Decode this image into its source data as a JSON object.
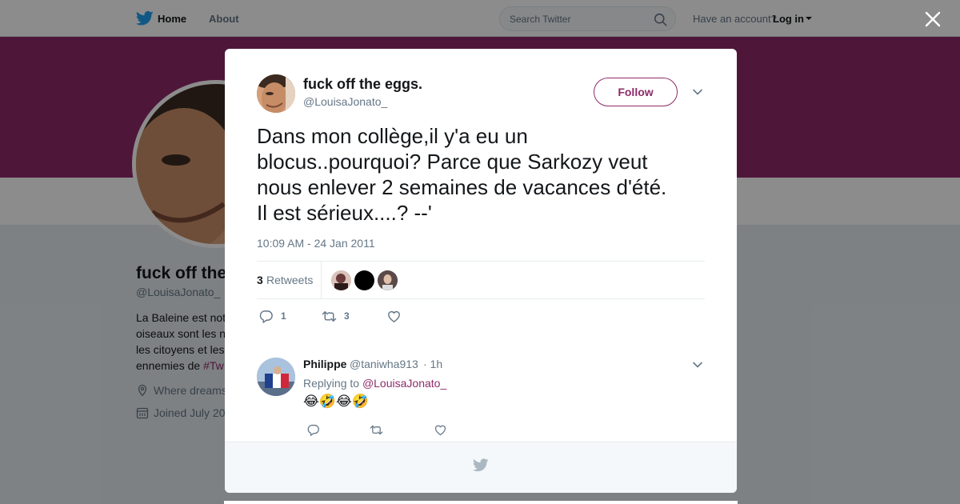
{
  "nav": {
    "home_label": "Home",
    "about_label": "About",
    "search_placeholder": "Search Twitter",
    "have_account": "Have an account?",
    "login_label": "Log in"
  },
  "profile": {
    "name": "fuck off the",
    "handle": "@LouisaJonato_",
    "bio_lines": [
      "La Baleine est not",
      "oiseaux sont les n",
      "les citoyens et les",
      "ennemies de "
    ],
    "bio_hashtag": "#Tw",
    "location": "Where dreams",
    "joined": "Joined July 20",
    "banner_color": "#8e2b6a"
  },
  "tweet": {
    "author_name": "fuck off the eggs.",
    "author_handle": "@LouisaJonato_",
    "follow_label": "Follow",
    "text": "Dans mon collège,il y'a eu un\nblocus..pourquoi? Parce que Sarkozy veut\nnous enlever 2 semaines de vacances d'été.\nIl est sérieux....?  --'",
    "timestamp": "10:09 AM - 24 Jan 2011",
    "retweet_count": "3",
    "retweet_label": "Retweets",
    "reply_count": "1",
    "retweet_action_count": "3"
  },
  "reply": {
    "name": "Philippe",
    "handle": "@taniwha913",
    "time": "· 1h",
    "replying_prefix": "Replying to ",
    "replying_mention": "@LouisaJonato_",
    "text": "😂🤣😂🤣"
  },
  "colors": {
    "accent": "#8e2b6a",
    "twitter_blue": "#1da1f2",
    "muted": "#657786"
  }
}
